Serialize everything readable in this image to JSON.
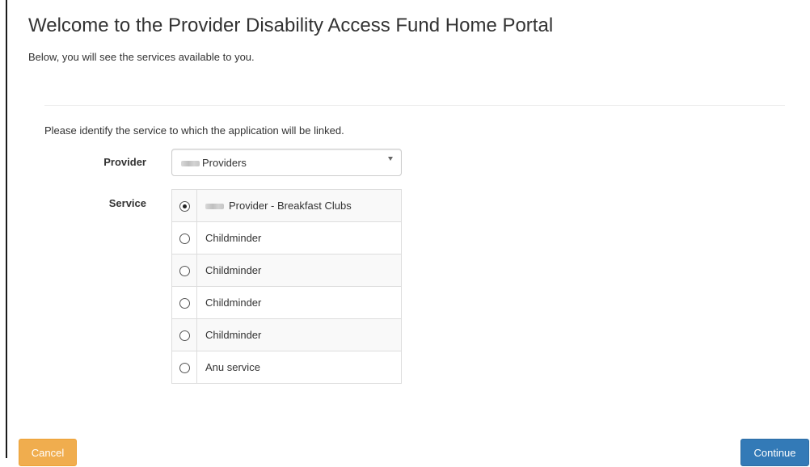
{
  "page": {
    "title": "Welcome to the Provider Disability Access Fund Home Portal",
    "subtitle": "Below, you will see the services available to you.",
    "instruction": "Please identify the service to which the application will be linked."
  },
  "provider": {
    "label": "Provider",
    "selected_value": "Providers"
  },
  "service": {
    "label": "Service",
    "options": [
      {
        "name": "Provider - Breakfast Clubs",
        "checked": true
      },
      {
        "name": "Childminder",
        "checked": false
      },
      {
        "name": "Childminder",
        "checked": false
      },
      {
        "name": "Childminder",
        "checked": false
      },
      {
        "name": "Childminder",
        "checked": false
      },
      {
        "name": "Anu service",
        "checked": false
      }
    ]
  },
  "actions": {
    "cancel_label": "Cancel",
    "continue_label": "Continue"
  },
  "colors": {
    "cancel": "#f0ad4e",
    "continue": "#337ab7",
    "text": "#333333",
    "row_stripe": "#f9f9f9",
    "border": "#dddddd"
  },
  "icons": {
    "select_caret": "chevron-down-icon",
    "radio": "radio-icon"
  }
}
